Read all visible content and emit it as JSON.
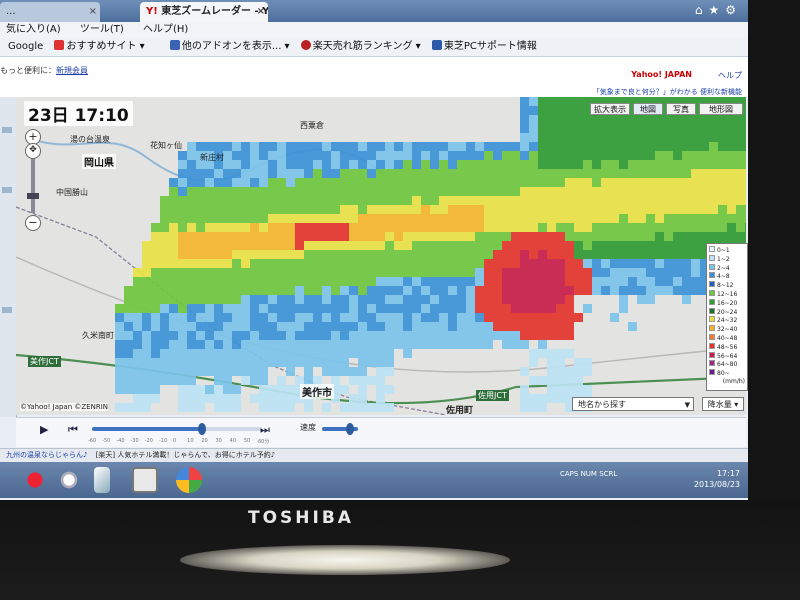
{
  "browser": {
    "tabs": [
      {
        "label": "...",
        "active": false
      },
      {
        "label": "東芝ズームレーダー - Yah...",
        "active": true
      }
    ],
    "menu": [
      "気に入り(A)",
      "ツール(T)",
      "ヘルプ(H)"
    ],
    "bookmarks": [
      {
        "label": "Google",
        "icon": "google-icon"
      },
      {
        "label": "おすすめサイト ▾",
        "icon": "recommend-icon"
      },
      {
        "label": "他のアドオンを表示... ▾",
        "icon": "addon-icon"
      },
      {
        "label": "楽天売れ筋ランキング ▾",
        "icon": "rakuten-icon"
      },
      {
        "label": "東芝PCサポート情報",
        "icon": "toshiba-icon"
      }
    ]
  },
  "page": {
    "info_prefix": "もっと便利に",
    "info_link": "新規会員",
    "top_right_links": [
      "Yahoo! JAPAN",
      "ヘルプ"
    ],
    "top_right_caption": "「気象まで良と何分？」がわかる 便利な新機能"
  },
  "map": {
    "time_label": "23日 17:10",
    "buttons": [
      "拡大表示",
      "地図",
      "写真",
      "地形図"
    ],
    "region_label": "岡山県",
    "city_label": "美作市",
    "town_label": "佐用町",
    "jct_labels": [
      "佐用JCT",
      "美作JCT"
    ],
    "place_labels": [
      "湯の台温泉",
      "花知ヶ仙",
      "西粟倉",
      "中国勝山",
      "久米南町",
      "新庄村"
    ],
    "search_placeholder": "地名から探す",
    "water_label": "降水量",
    "copyright": "©Yahoo! Japan ©ZENRIN",
    "legend_title": "(mm/h)",
    "legend": [
      {
        "label": "0~1",
        "color": "#e9f3fb"
      },
      {
        "label": "1~2",
        "color": "#bde3f4"
      },
      {
        "label": "2~4",
        "color": "#7cc3ea"
      },
      {
        "label": "4~8",
        "color": "#3c91d6"
      },
      {
        "label": "8~12",
        "color": "#1f5fc0"
      },
      {
        "label": "12~16",
        "color": "#6fc53f"
      },
      {
        "label": "16~20",
        "color": "#2f9b33"
      },
      {
        "label": "20~24",
        "color": "#1f6f2a"
      },
      {
        "label": "24~32",
        "color": "#e8e245"
      },
      {
        "label": "32~40",
        "color": "#f3b52f"
      },
      {
        "label": "40~48",
        "color": "#f07a2b"
      },
      {
        "label": "48~56",
        "color": "#e2342b"
      },
      {
        "label": "56~64",
        "color": "#c71d49"
      },
      {
        "label": "64~80",
        "color": "#9e2a88"
      },
      {
        "label": "80~",
        "color": "#6b1f8f"
      }
    ],
    "radar_colors": {
      "light": "#bde3f4",
      "mid": "#7cc3ea",
      "blue": "#3c91d6",
      "green": "#6fc53f",
      "dgreen": "#2f9b33",
      "yellow": "#e8e245",
      "orange": "#f3b52f",
      "red": "#e2342b",
      "magenta": "#c71d49"
    }
  },
  "player": {
    "progress": 0.65,
    "ticks": [
      "-60",
      "-50",
      "-40",
      "-30",
      "-20",
      "-10",
      "0",
      "10",
      "20",
      "30",
      "40",
      "50",
      "60分"
    ],
    "speed_label": "速度"
  },
  "status": {
    "ad_text": "九州の温泉ならじゃらん♪",
    "promo_text": "[楽天] 人気ホテル満載！じゃらんで、お得にホテル予約♪"
  },
  "taskbar": {
    "tray_text": "CAPS NUM SCRL",
    "time": "17:17",
    "date": "2013/08/23"
  },
  "brand": "TOSHIBA"
}
